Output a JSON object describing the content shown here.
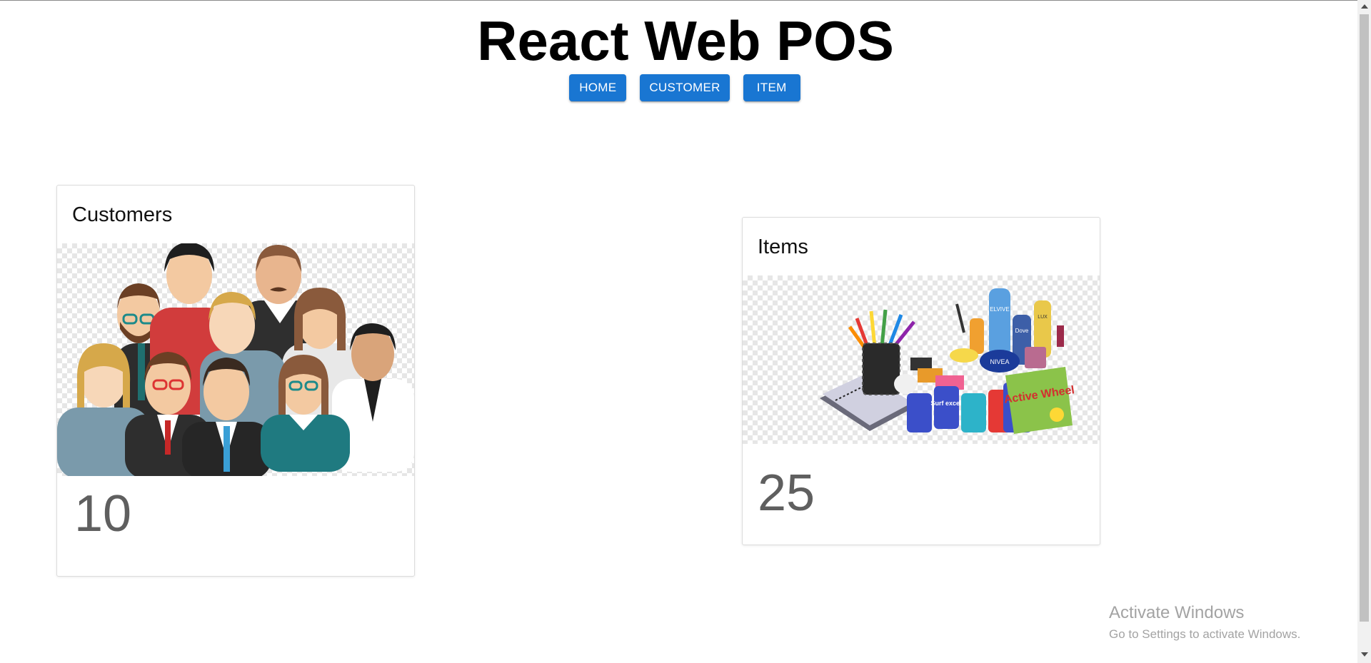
{
  "app": {
    "title": "React Web POS"
  },
  "nav": {
    "buttons": [
      "Home",
      "Customer",
      "Item"
    ]
  },
  "cards": {
    "customers": {
      "title": "Customers",
      "count": "10"
    },
    "items": {
      "title": "Items",
      "count": "25"
    }
  },
  "product_labels": [
    "ELVIVE",
    "Dove",
    "LUX",
    "NIVEA",
    "Surf excel",
    "Active Wheel"
  ],
  "watermark": {
    "title": "Activate Windows",
    "subtitle": "Go to Settings to activate Windows."
  },
  "colors": {
    "accent": "#1976d2",
    "count_text": "#5f5f5f"
  }
}
